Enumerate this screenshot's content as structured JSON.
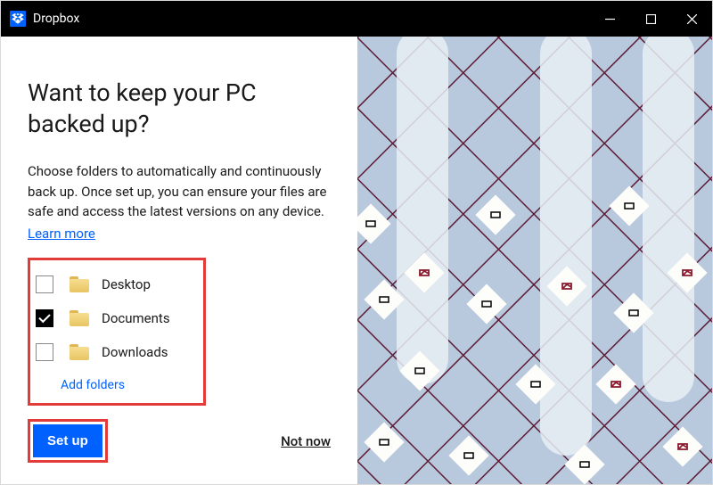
{
  "titlebar": {
    "title": "Dropbox"
  },
  "heading": "Want to keep your PC backed up?",
  "description": "Choose folders to automatically and continuously back up. Once set up, you can ensure your files are safe and access the latest versions on any device.",
  "learn_more": "Learn more",
  "folders": {
    "items": [
      {
        "label": "Desktop",
        "checked": false
      },
      {
        "label": "Documents",
        "checked": true
      },
      {
        "label": "Downloads",
        "checked": false
      }
    ],
    "add_label": "Add folders"
  },
  "actions": {
    "setup": "Set up",
    "not_now": "Not now"
  }
}
